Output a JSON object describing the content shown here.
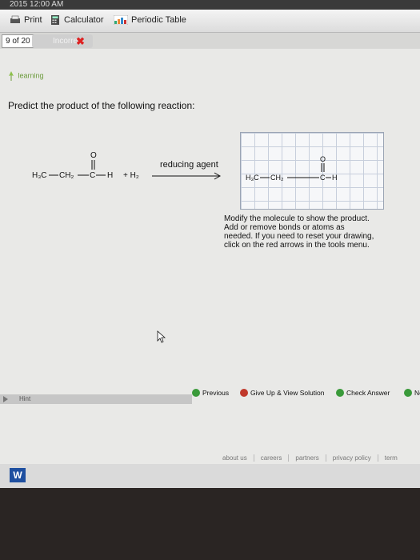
{
  "topbar": {
    "time_text": "2015 12:00 AM"
  },
  "toolbar": {
    "print": "Print",
    "calculator": "Calculator",
    "periodic_table": "Periodic Table"
  },
  "pager": {
    "position": "9 of 20",
    "status": "Incorrect"
  },
  "brand": {
    "logo_text": "learning"
  },
  "question": {
    "prompt": "Predict the product of the following reaction:"
  },
  "reaction": {
    "reactant_left": "H₃C",
    "reactant_mid": "CH₂",
    "reactant_c": "C",
    "reactant_h": "H",
    "carbonyl_o": "O",
    "plus_h2": "+ H₂",
    "arrow_label": "reducing agent"
  },
  "drawing": {
    "left": "H₃C",
    "mid": "CH₂",
    "c": "C",
    "h": "H",
    "o": "O"
  },
  "instructions": {
    "line1": "Modify the molecule to show the product.",
    "line2": "Add or remove bonds or atoms as",
    "line3": "needed. If you need to reset your drawing,",
    "line4": "click on the red arrows in the tools menu."
  },
  "actions": {
    "hint": "Hint",
    "previous": "Previous",
    "give_up": "Give Up & View Solution",
    "check": "Check Answer",
    "next": "Ne"
  },
  "footer": {
    "about": "about us",
    "careers": "careers",
    "partners": "partners",
    "privacy": "privacy policy",
    "terms": "term"
  },
  "taskbar": {
    "word_icon": "W"
  },
  "colors": {
    "incorrect": "#d22222",
    "check_green": "#3a9a3a",
    "give_up_red": "#c0392b"
  }
}
